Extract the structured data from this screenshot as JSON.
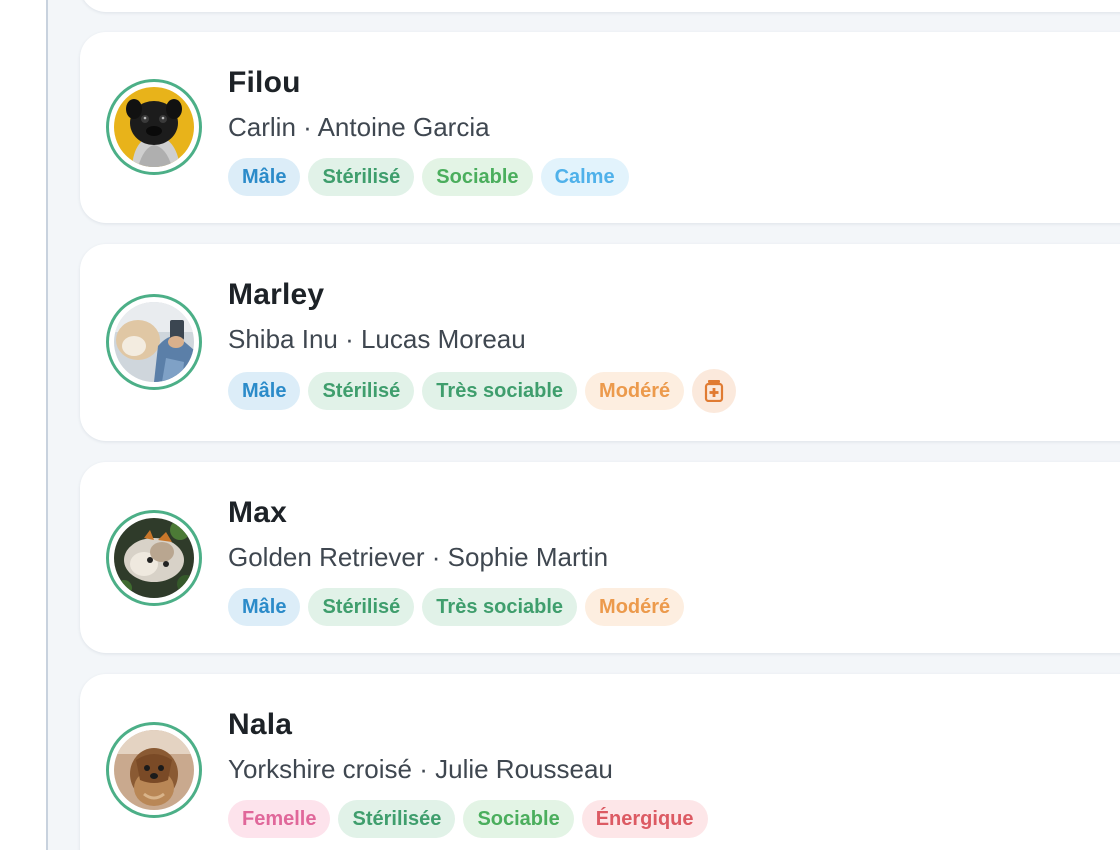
{
  "pets": [
    {
      "name": "Filou",
      "breed": "Carlin",
      "owner": "Antoine Garcia",
      "subtitle": "Carlin · Antoine Garcia",
      "tags": [
        "Mâle",
        "Stérilisé",
        "Sociable",
        "Calme"
      ]
    },
    {
      "name": "Marley",
      "breed": "Shiba Inu",
      "owner": "Lucas Moreau",
      "subtitle": "Shiba Inu · Lucas Moreau",
      "tags": [
        "Mâle",
        "Stérilisé",
        "Très sociable",
        "Modéré"
      ],
      "badge_icon": "medicine-icon"
    },
    {
      "name": "Max",
      "breed": "Golden Retriever",
      "owner": "Sophie Martin",
      "subtitle": "Golden Retriever · Sophie Martin",
      "tags": [
        "Mâle",
        "Stérilisé",
        "Très sociable",
        "Modéré"
      ]
    },
    {
      "name": "Nala",
      "breed": "Yorkshire croisé",
      "owner": "Julie Rousseau",
      "subtitle": "Yorkshire croisé · Julie Rousseau",
      "tags": [
        "Femelle",
        "Stérilisée",
        "Sociable",
        "Énergique"
      ]
    }
  ],
  "colors": {
    "avatar_ring": "#4caf87",
    "sex_male": "#2b8bc9",
    "sex_female": "#e0679a",
    "sterilized": "#3f9e6d",
    "sociable": "#4bae5d",
    "calm": "#4fb1ea",
    "moderate": "#ec9a4c",
    "energetic": "#dc5a63"
  }
}
